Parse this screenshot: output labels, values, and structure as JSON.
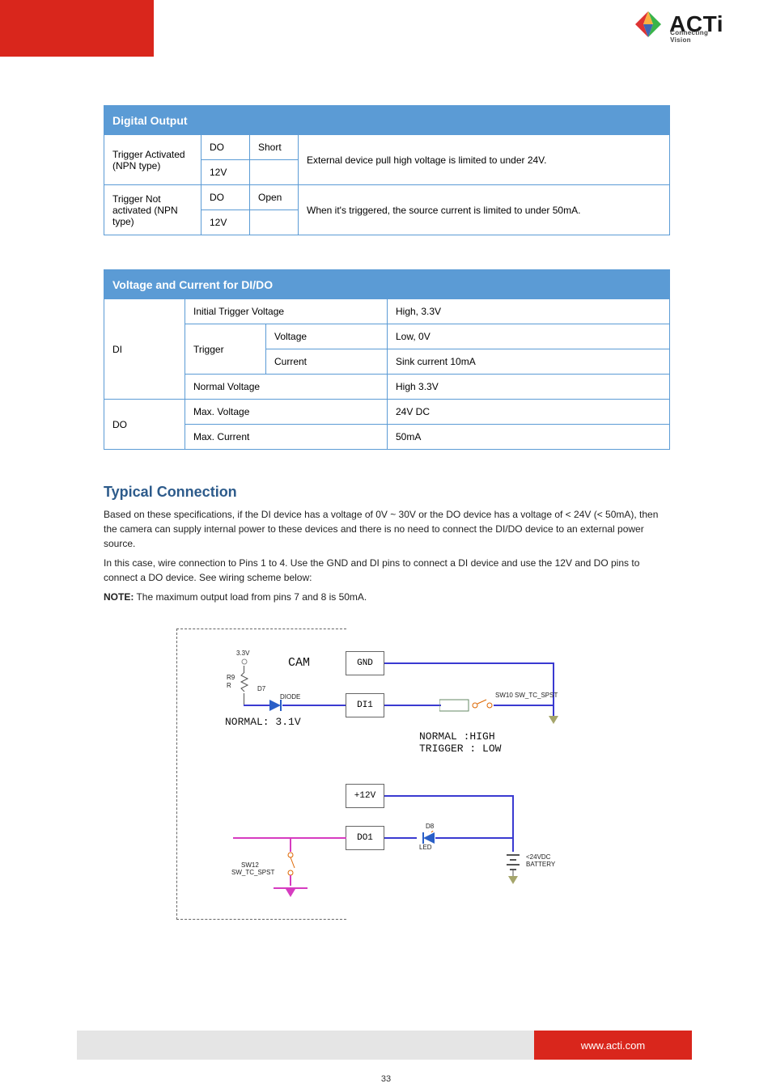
{
  "logo": {
    "brand": "ACTi",
    "tagline": "Connecting Vision"
  },
  "table1": {
    "header": "Digital Output",
    "rows": [
      {
        "item": "Trigger Activated (NPN type)",
        "pin1": "DO",
        "pin2": "Short",
        "desc_rowspan": "External device pull high voltage is limited to under 24V.",
        "desc_row2_pin1": "12V",
        "desc_row2_pin2": ""
      },
      {
        "item": "Trigger Not activated (NPN type)",
        "pin1": "DO",
        "pin2": "Open",
        "desc_rowspan": "When it's triggered, the source current is limited to under 50mA.",
        "desc_row2_pin1": "12V",
        "desc_row2_pin2": ""
      }
    ]
  },
  "table2": {
    "header": "Voltage and Current for DI/DO",
    "row_di": {
      "label": "DI",
      "initial_text": "Initial Trigger Voltage",
      "initial_val": "High, 3.3V",
      "trigger": "Trigger",
      "voltage_text": "Voltage",
      "voltage_val": "Low, 0V",
      "current_text": "Current",
      "current_val": "Sink current 10mA",
      "normal_text": "Normal Voltage",
      "normal_val": "High 3.3V"
    },
    "row_do": {
      "label": "DO",
      "max_v_text": "Max. Voltage",
      "max_v_val": "24V DC",
      "max_i_text": "Max. Current",
      "max_i_val": "50mA"
    }
  },
  "section_title": "Typical Connection",
  "body1": "Based on these specifications, if the DI device has a voltage of 0V ~ 30V or the DO device has a voltage of < 24V (< 50mA), then the camera can supply internal power to these devices and there is no need to connect the DI/DO device to an external power source.",
  "body2": "In this case, wire connection to Pins 1 to 4. Use the GND and DI pins to connect a DI device and use the 12V and DO pins to connect a DO device. See wiring scheme below:",
  "diagram": {
    "cam": "CAM",
    "normal_v": "NORMAL: 3.1V",
    "pins": {
      "gnd": "GND",
      "di1": "DI1",
      "p12": "+12V",
      "do1": "DO1"
    },
    "di_states": "NORMAL :HIGH\nTRIGGER : LOW",
    "sw_label": "SW10 SW_TC_SPST",
    "sw2_label_a": "SW12",
    "sw2_label_b": "SW_TC_SPST",
    "r_label_a": "R9",
    "r_label_b": "R",
    "d_label_a": "D8",
    "d_label_b": "",
    "diode_label": "DIODE",
    "d7_label": "D7",
    "d8_label": "D8",
    "led_label": "LED",
    "batt_label": "<24VDC\nBATTERY",
    "v33": "3.3V"
  },
  "note_label": "NOTE:",
  "note_text": " The maximum output load from pins 7 and 8 is 50mA.",
  "footer_url": "www.acti.com",
  "page_num": "33"
}
